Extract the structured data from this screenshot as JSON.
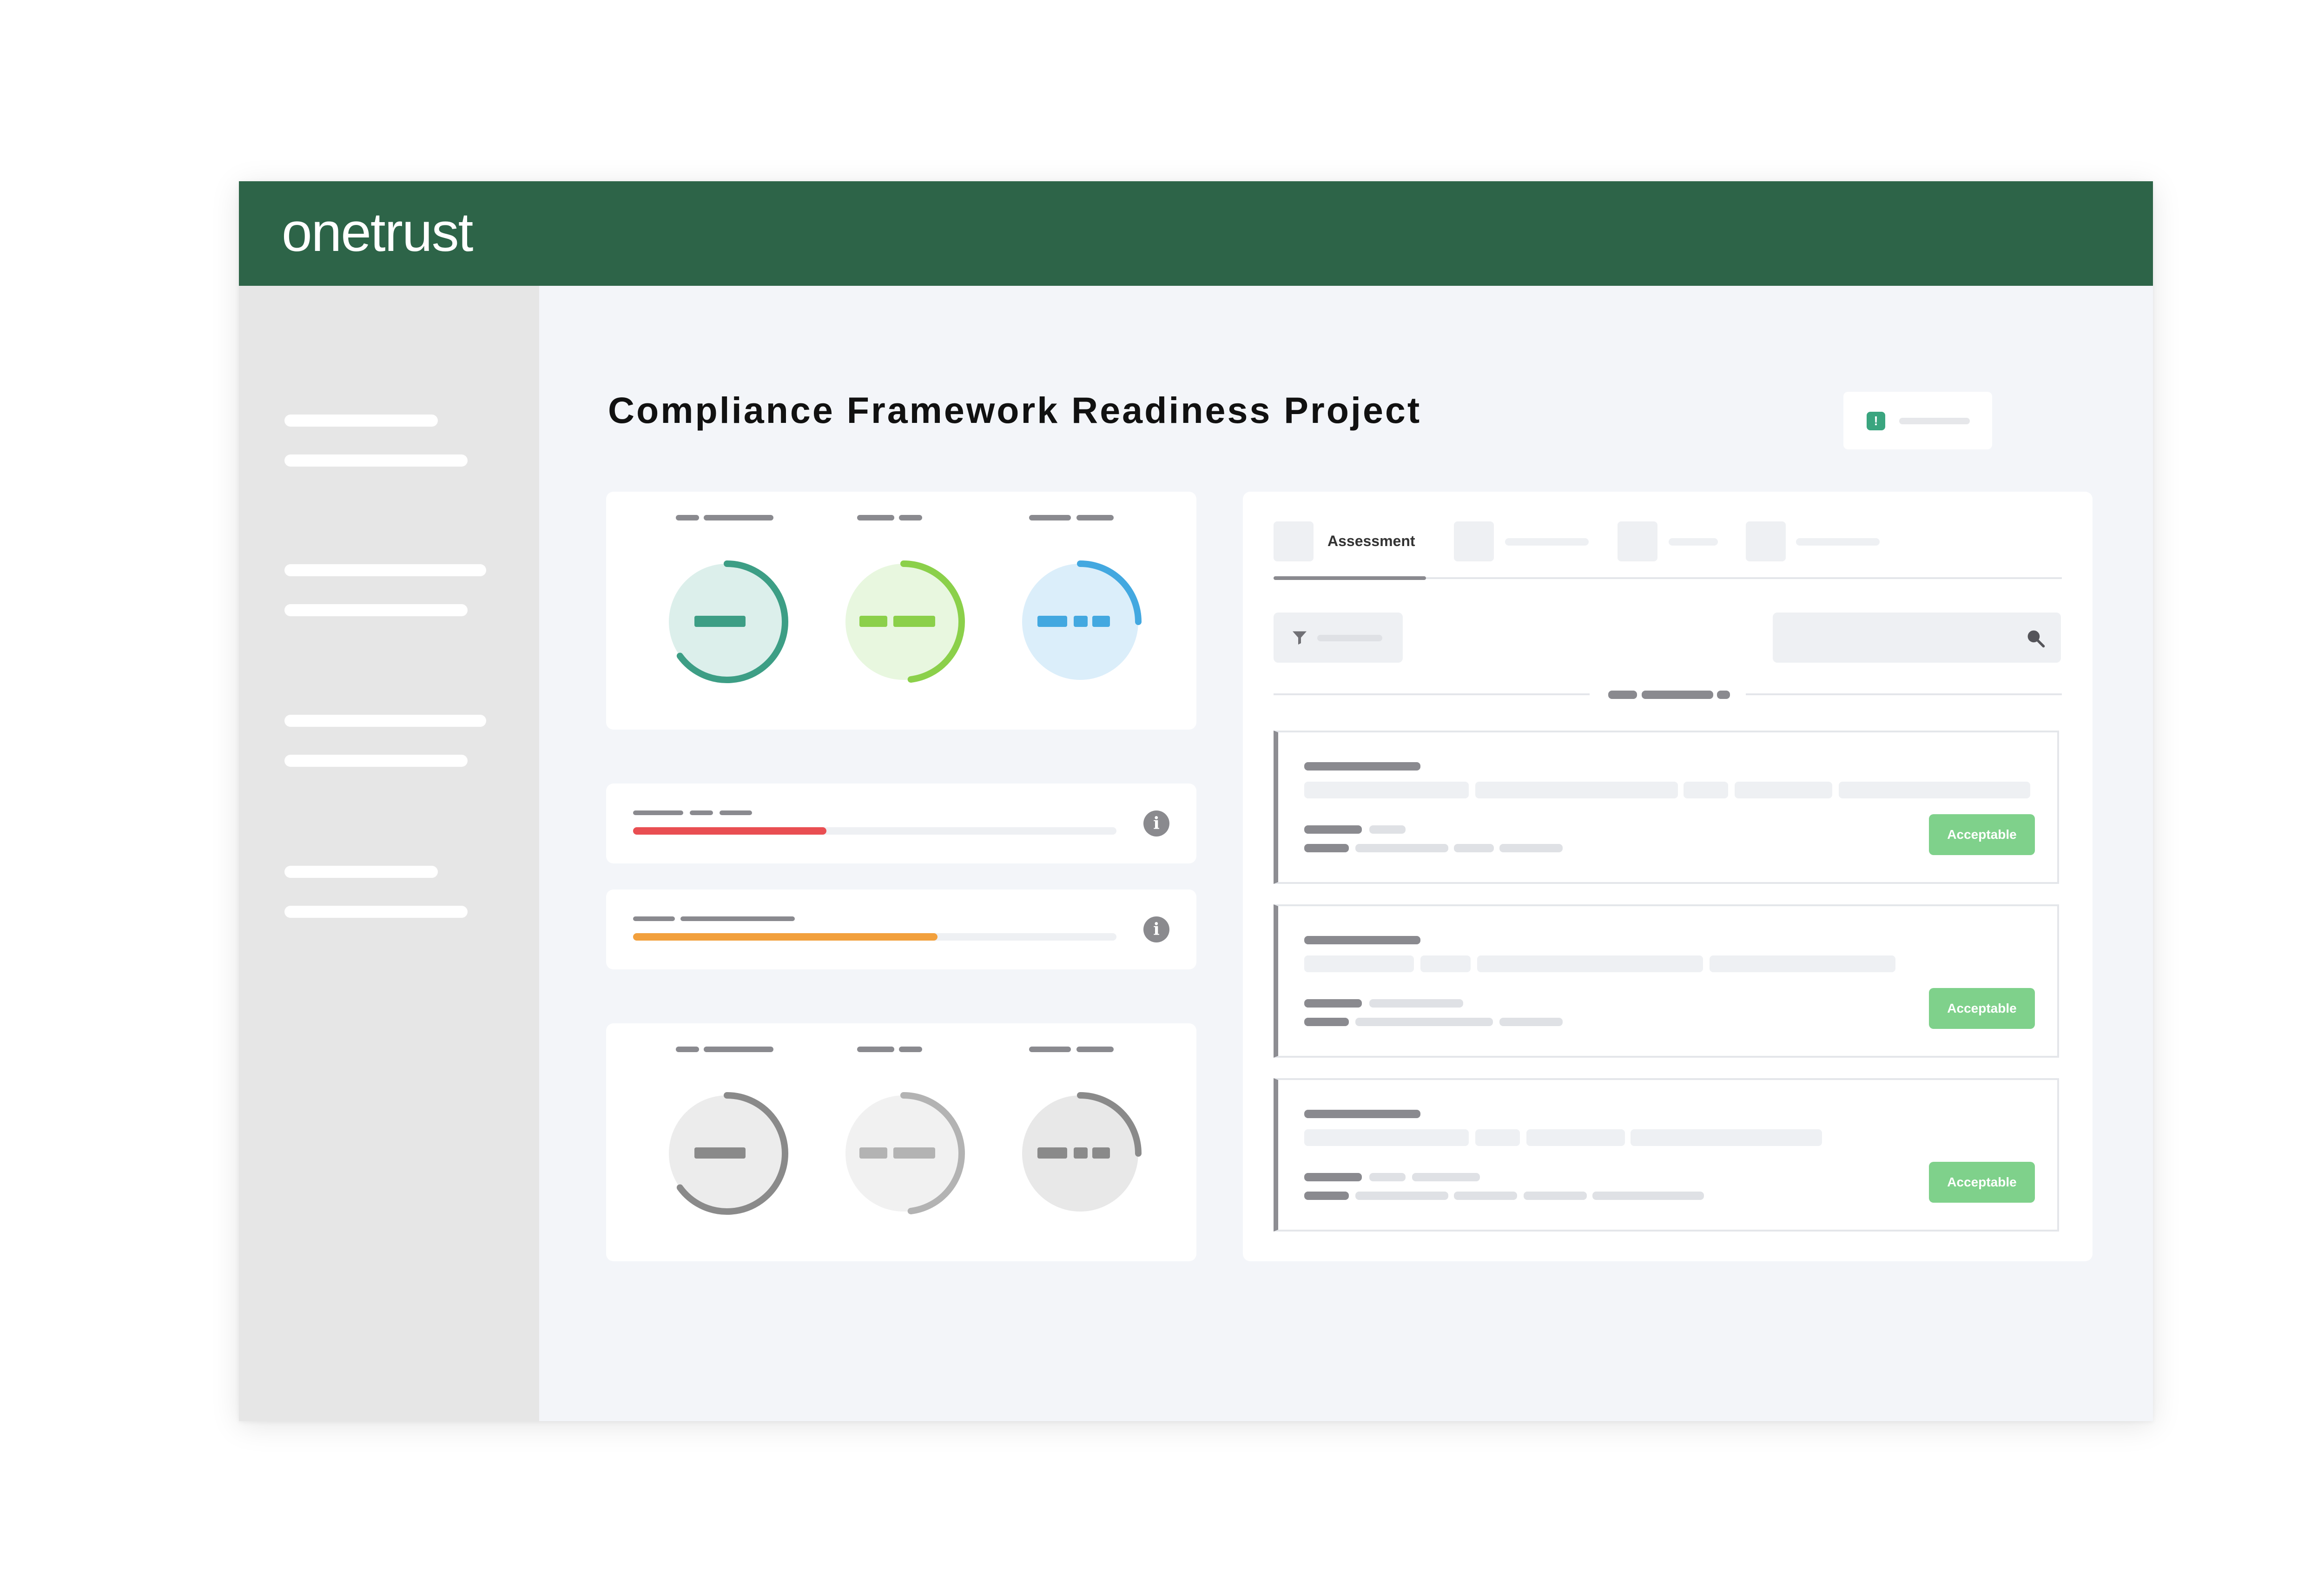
{
  "app": {
    "logo": "onetrust",
    "brand_color": "#2d6448"
  },
  "page": {
    "title": "Compliance Framework Readiness Project"
  },
  "assessment_panel": {
    "tabs": [
      {
        "label": "Assessment",
        "active": true
      }
    ],
    "search_icon": "search-icon",
    "filter_icon": "filter-icon",
    "items": [
      {
        "status": "Acceptable",
        "status_color": "#7fd18b"
      },
      {
        "status": "Acceptable",
        "status_color": "#7fd18b"
      },
      {
        "status": "Acceptable",
        "status_color": "#7fd18b"
      }
    ]
  },
  "gauges_top": [
    {
      "color": "#3d9e85",
      "fill": "#dcefeb",
      "progress": 0.65
    },
    {
      "color": "#8bd04a",
      "fill": "#e8f7df",
      "progress": 0.48
    },
    {
      "color": "#43a8e0",
      "fill": "#dbeefa",
      "progress": 0.25
    }
  ],
  "gauges_bottom": [
    {
      "color": "#8a8a8a",
      "fill": "#ececec",
      "progress": 0.65
    },
    {
      "color": "#b3b3b3",
      "fill": "#f1f1f1",
      "progress": 0.48
    },
    {
      "color": "#8a8a8a",
      "fill": "#e8e8e8",
      "progress": 0.25
    }
  ],
  "progress_bars": [
    {
      "color": "#e94e52",
      "progress": 0.4,
      "icon": "info-icon"
    },
    {
      "color": "#f2a03d",
      "progress": 0.63,
      "icon": "info-icon"
    }
  ]
}
